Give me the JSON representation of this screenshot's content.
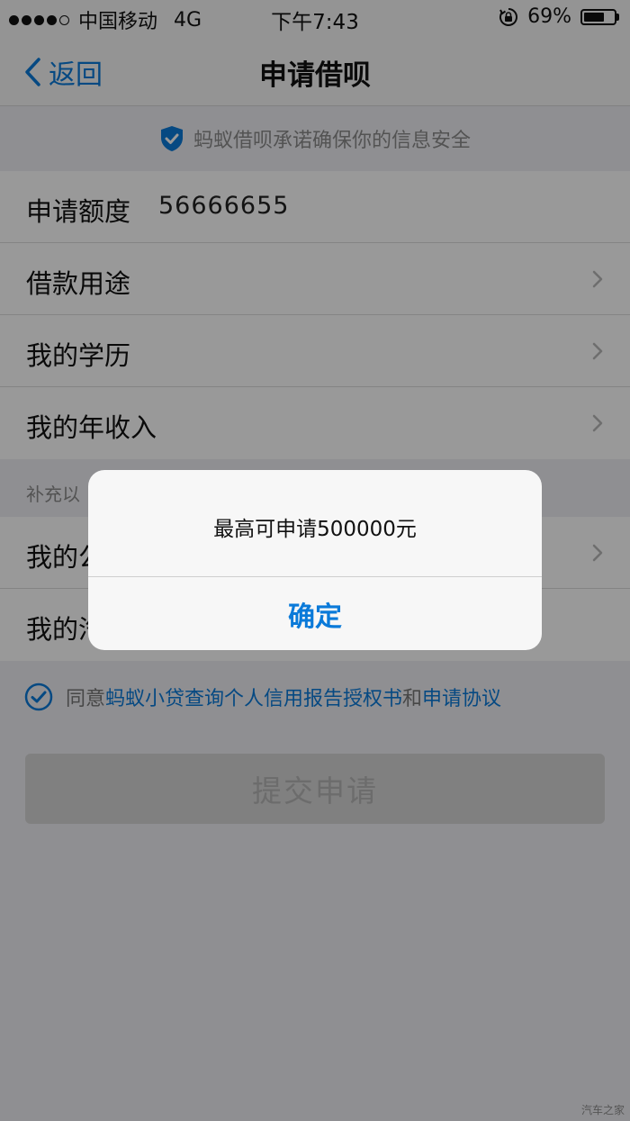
{
  "status_bar": {
    "carrier": "中国移动",
    "network": "4G",
    "time": "下午7:43",
    "battery": "69%",
    "battery_level": 0.69
  },
  "nav": {
    "back_label": "返回",
    "title": "申请借呗"
  },
  "banner": {
    "text": "蚂蚁借呗承诺确保你的信息安全"
  },
  "form": {
    "amount_label": "申请额度",
    "amount_value": "56666655",
    "rows": [
      {
        "label": "借款用途"
      },
      {
        "label": "我的学历"
      },
      {
        "label": "我的年收入"
      }
    ],
    "section_note": "补充以",
    "rows2": [
      {
        "label": "我的公"
      },
      {
        "label": "我的汽"
      }
    ]
  },
  "agreement": {
    "prefix": "同意",
    "link1": "蚂蚁小贷查询个人信用报告授权书",
    "conj": "和",
    "link2": "申请协议"
  },
  "submit_label": "提交申请",
  "alert": {
    "message": "最高可申请500000元",
    "confirm": "确定"
  },
  "watermark": "汽车之家",
  "colors": {
    "accent": "#0a7ad9",
    "background": "#efeff4"
  }
}
